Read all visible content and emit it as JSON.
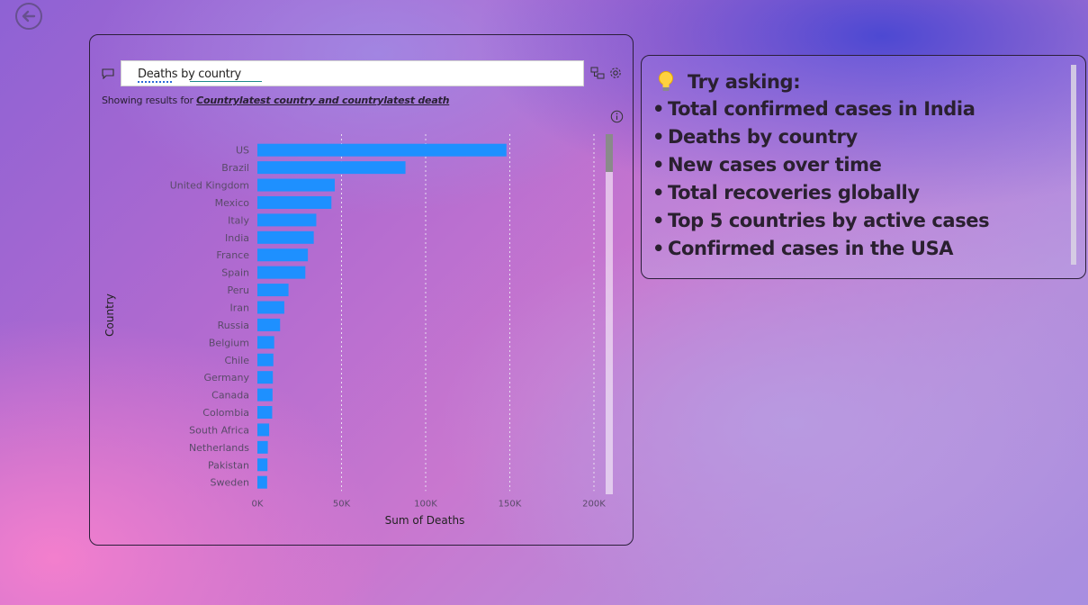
{
  "qa": {
    "query": "Deaths by country",
    "results_prefix": "Showing results for ",
    "results_terms": "Countrylatest country and countrylatest death"
  },
  "tips": {
    "title": "Try asking:",
    "items": [
      "Total confirmed cases in India",
      "Deaths by country",
      "New cases over time",
      "Total recoveries globally",
      "Top 5 countries by active cases",
      "Confirmed cases in the USA"
    ]
  },
  "colors": {
    "bar": "#1e90ff",
    "accent_text": "#2a2030"
  },
  "icons": [
    "back-arrow-icon",
    "chat-bubble-icon",
    "field-list-icon",
    "settings-icon",
    "info-icon",
    "lightbulb-icon"
  ],
  "chart_data": {
    "type": "bar",
    "orientation": "horizontal",
    "xlabel": "Sum of Deaths",
    "ylabel": "Country",
    "xlim": [
      0,
      200000
    ],
    "xticks": [
      "0K",
      "50K",
      "100K",
      "150K",
      "200K"
    ],
    "grid": true,
    "categories": [
      "US",
      "Brazil",
      "United Kingdom",
      "Mexico",
      "Italy",
      "India",
      "France",
      "Spain",
      "Peru",
      "Iran",
      "Russia",
      "Belgium",
      "Chile",
      "Germany",
      "Canada",
      "Colombia",
      "South Africa",
      "Netherlands",
      "Pakistan",
      "Sweden"
    ],
    "values": [
      148000,
      88000,
      46000,
      44000,
      35000,
      33500,
      30000,
      28500,
      18500,
      16000,
      13500,
      10000,
      9500,
      9200,
      9000,
      8800,
      7000,
      6200,
      6000,
      5800
    ]
  }
}
